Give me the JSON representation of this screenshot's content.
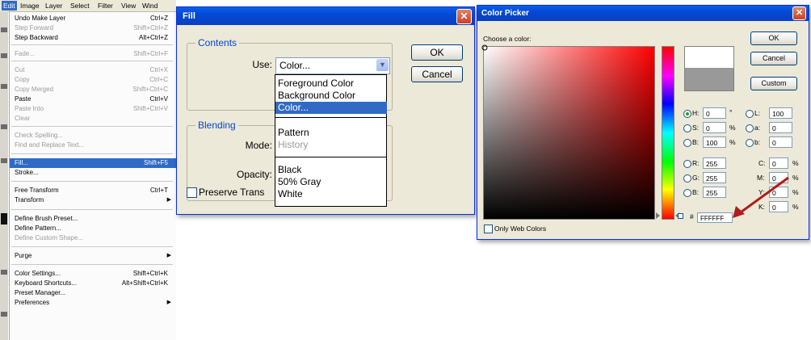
{
  "menubar": {
    "items": [
      "Edit",
      "Image",
      "Layer",
      "Select",
      "Filter",
      "View",
      "Wind"
    ],
    "active": "Edit"
  },
  "edit_menu": {
    "items": [
      {
        "label": "Undo Make Layer",
        "shortcut": "Ctrl+Z",
        "disabled": false
      },
      {
        "label": "Step Forward",
        "shortcut": "Shift+Ctrl+Z",
        "disabled": true
      },
      {
        "label": "Step Backward",
        "shortcut": "Alt+Ctrl+Z",
        "disabled": false
      },
      {
        "label": "Fade...",
        "shortcut": "Shift+Ctrl+F",
        "disabled": true
      },
      {
        "label": "Cut",
        "shortcut": "Ctrl+X",
        "disabled": true
      },
      {
        "label": "Copy",
        "shortcut": "Ctrl+C",
        "disabled": true
      },
      {
        "label": "Copy Merged",
        "shortcut": "Shift+Ctrl+C",
        "disabled": true
      },
      {
        "label": "Paste",
        "shortcut": "Ctrl+V",
        "disabled": false
      },
      {
        "label": "Paste Into",
        "shortcut": "Shift+Ctrl+V",
        "disabled": true
      },
      {
        "label": "Clear",
        "shortcut": "",
        "disabled": true
      },
      {
        "label": "Check Spelling...",
        "shortcut": "",
        "disabled": true
      },
      {
        "label": "Find and Replace Text...",
        "shortcut": "",
        "disabled": true
      },
      {
        "label": "Fill...",
        "shortcut": "Shift+F5",
        "disabled": false,
        "highlighted": true
      },
      {
        "label": "Stroke...",
        "shortcut": "",
        "disabled": false
      },
      {
        "label": "Free Transform",
        "shortcut": "Ctrl+T",
        "disabled": false
      },
      {
        "label": "Transform",
        "shortcut": "",
        "disabled": false,
        "submenu": true
      },
      {
        "label": "Define Brush Preset...",
        "shortcut": "",
        "disabled": false
      },
      {
        "label": "Define Pattern...",
        "shortcut": "",
        "disabled": false
      },
      {
        "label": "Define Custom Shape...",
        "shortcut": "",
        "disabled": true
      },
      {
        "label": "Purge",
        "shortcut": "",
        "disabled": false,
        "submenu": true
      },
      {
        "label": "Color Settings...",
        "shortcut": "Shift+Ctrl+K",
        "disabled": false
      },
      {
        "label": "Keyboard Shortcuts...",
        "shortcut": "Alt+Shift+Ctrl+K",
        "disabled": false
      },
      {
        "label": "Preset Manager...",
        "shortcut": "",
        "disabled": false
      },
      {
        "label": "Preferences",
        "shortcut": "",
        "disabled": false,
        "submenu": true
      }
    ]
  },
  "fill_dialog": {
    "title": "Fill",
    "contents_legend": "Contents",
    "use_label": "Use:",
    "use_value": "Color...",
    "use_options": [
      "Foreground Color",
      "Background Color",
      "Color...",
      "Pattern",
      "History",
      "Black",
      "50% Gray",
      "White"
    ],
    "blending_legend": "Blending",
    "mode_label": "Mode:",
    "opacity_label": "Opacity:",
    "preserve_label": "Preserve Trans",
    "ok_label": "OK",
    "cancel_label": "Cancel"
  },
  "color_picker": {
    "title": "Color Picker",
    "choose_label": "Choose a color:",
    "ok_label": "OK",
    "cancel_label": "Cancel",
    "custom_label": "Custom",
    "fields": {
      "H": "0",
      "S": "0",
      "B": "100",
      "R": "255",
      "G": "255",
      "B2": "255",
      "L": "100",
      "a": "0",
      "b": "0",
      "C": "0",
      "M": "0",
      "Y": "0",
      "K": "0",
      "hex": "FFFFFF"
    },
    "labels": {
      "H": "H:",
      "S": "S:",
      "B": "B:",
      "R": "R:",
      "G": "G:",
      "B2": "B:",
      "L": "L:",
      "a": "a:",
      "b": "b:",
      "C": "C:",
      "M": "M:",
      "Y": "Y:",
      "K": "K:",
      "deg": "°",
      "pct": "%",
      "hash": "#"
    },
    "web_only_label": "Only Web Colors",
    "colors": {
      "new": "#ffffff",
      "current": "#999999",
      "accent_arrow": "#b01c1c"
    }
  }
}
